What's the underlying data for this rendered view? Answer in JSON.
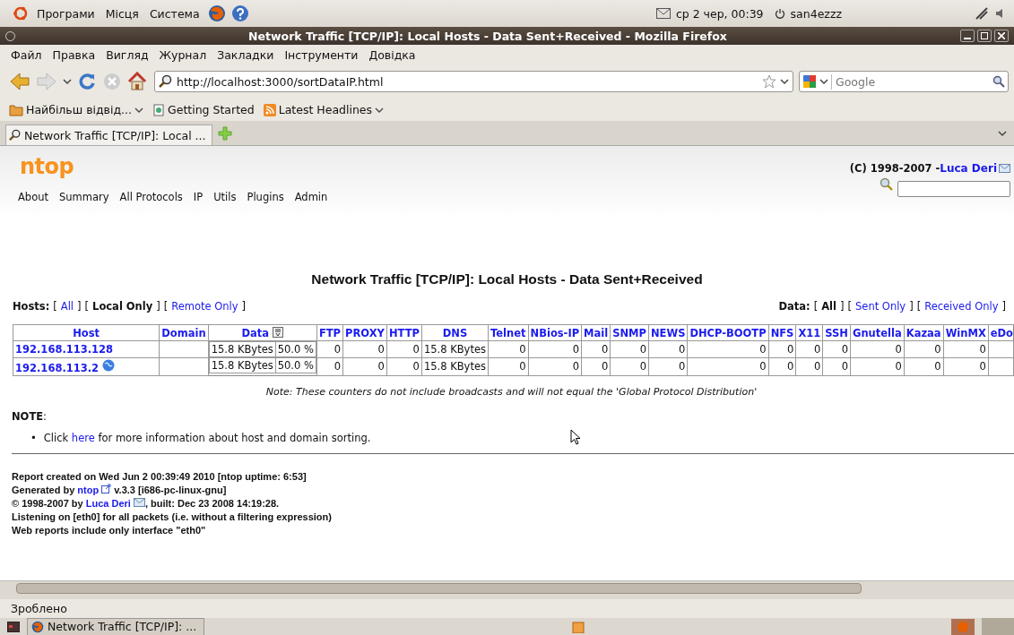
{
  "top_panel": {
    "menus": [
      "Програми",
      "Місця",
      "Система"
    ],
    "clock": "ср  2 чер, 00:39",
    "user": "san4ezzz"
  },
  "window": {
    "title": "Network Traffic [TCP/IP]: Local Hosts - Data Sent+Received - Mozilla Firefox"
  },
  "menubar": [
    "Файл",
    "Правка",
    "Вигляд",
    "Журнал",
    "Закладки",
    "Інструменти",
    "Довідка"
  ],
  "navbar": {
    "url": "http://localhost:3000/sortDataIP.html",
    "search_placeholder": "Google"
  },
  "bookmarks": [
    "Найбільш відвід...",
    "Getting Started",
    "Latest Headlines"
  ],
  "tabs": [
    {
      "label": "Network Traffic [TCP/IP]: Local ...",
      "selected": true
    }
  ],
  "page": {
    "logo": "ntop",
    "copyright": "(C) 1998-2007 - ",
    "author": "Luca Deri",
    "nav": [
      "About",
      "Summary",
      "All Protocols",
      "IP",
      "Utils",
      "Plugins",
      "Admin"
    ],
    "heading": "Network Traffic [TCP/IP]: Local Hosts - Data Sent+Received",
    "hosts_filter": {
      "label": "Hosts:",
      "open": "[",
      "close": "]",
      "options": [
        {
          "label": "All",
          "selected": false
        },
        {
          "label": "Local Only",
          "selected": true
        },
        {
          "label": "Remote Only",
          "selected": false
        }
      ]
    },
    "data_filter": {
      "label": "Data:",
      "open": "[",
      "close": "]",
      "options": [
        {
          "label": "All",
          "selected": true
        },
        {
          "label": "Sent Only",
          "selected": false
        },
        {
          "label": "Received Only",
          "selected": false
        }
      ]
    },
    "table": {
      "columns": [
        "Host",
        "Domain",
        "Data",
        "FTP",
        "PROXY",
        "HTTP",
        "DNS",
        "Telnet",
        "NBios-IP",
        "Mail",
        "SNMP",
        "NEWS",
        "DHCP-BOOTP",
        "NFS",
        "X11",
        "SSH",
        "Gnutella",
        "Kazaa",
        "WinMX",
        "eDo"
      ],
      "rows": [
        {
          "globe": false,
          "data_share": "50.0 %",
          "cells": [
            "192.168.113.128",
            "",
            "15.8 KBytes",
            "0",
            "0",
            "0",
            "15.8 KBytes",
            "0",
            "0",
            "0",
            "0",
            "0",
            "0",
            "0",
            "0",
            "0",
            "0",
            "0",
            "0"
          ]
        },
        {
          "globe": true,
          "data_share": "50.0 %",
          "cells": [
            "192.168.113.2",
            "",
            "15.8 KBytes",
            "0",
            "0",
            "0",
            "15.8 KBytes",
            "0",
            "0",
            "0",
            "0",
            "0",
            "0",
            "0",
            "0",
            "0",
            "0",
            "0",
            "0"
          ]
        }
      ]
    },
    "table_note": "Note: These counters do not include broadcasts and will not equal the 'Global Protocol Distribution'",
    "note_label": "NOTE",
    "note_colon": ":",
    "note_items": [
      {
        "bullet": "•",
        "before": "Click ",
        "link": "here",
        "after": " for more information about host and domain sorting."
      }
    ],
    "footer": {
      "report": "Report created on Wed Jun 2 00:39:49 2010 [ntop uptime: 6:53]",
      "generated_before": "Generated by ",
      "generated_link": "ntop",
      "generated_after": " v.3.3 [i686-pc-linux-gnu]",
      "copy_before": "© 1998-2007 by ",
      "copy_link": "Luca Deri",
      "copy_after": ", built: Dec 23 2008 14:19:28.",
      "listening": "Listening on [eth0] for all packets (i.e. without a filtering expression)",
      "web": "Web reports include only interface \"eth0\""
    }
  },
  "status_bar": "Зроблено",
  "taskbar": [
    {
      "label": "Network Traffic [TCP/IP]: ...",
      "selected": true
    }
  ]
}
